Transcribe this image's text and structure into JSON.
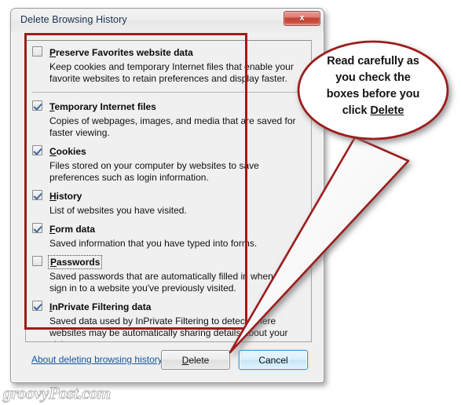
{
  "window": {
    "title": "Delete Browsing History",
    "close_label": "x",
    "close_icon": "close-icon"
  },
  "list": {
    "items": [
      {
        "checked": false,
        "accel_prefix": "P",
        "accel_rest": "reserve Favorites website data",
        "label": "Preserve Favorites website data",
        "desc": "Keep cookies and temporary Internet files that enable your favorite websites to retain preferences and display faster.",
        "focused": false,
        "separator_after": true
      },
      {
        "checked": true,
        "accel_prefix": "T",
        "accel_rest": "emporary Internet files",
        "label": "Temporary Internet files",
        "desc": "Copies of webpages, images, and media that are saved for faster viewing.",
        "focused": false,
        "separator_after": false
      },
      {
        "checked": true,
        "accel_prefix": "C",
        "accel_rest": "ookies",
        "label": "Cookies",
        "desc": "Files stored on your computer by websites to save preferences such as login information.",
        "focused": false,
        "separator_after": false
      },
      {
        "checked": true,
        "accel_prefix": "H",
        "accel_rest": "istory",
        "label": "History",
        "desc": "List of websites you have visited.",
        "focused": false,
        "separator_after": false
      },
      {
        "checked": true,
        "accel_prefix": "F",
        "accel_rest": "orm data",
        "label": "Form data",
        "desc": "Saved information that you have typed into forms.",
        "focused": false,
        "separator_after": false
      },
      {
        "checked": false,
        "accel_prefix": "P",
        "accel_rest": "asswords",
        "label": "Passwords",
        "desc": "Saved passwords that are automatically filled in when you sign in to a website you've previously visited.",
        "focused": true,
        "separator_after": false
      },
      {
        "checked": true,
        "accel_prefix": "I",
        "accel_rest": "nPrivate Filtering data",
        "label": "InPrivate Filtering data",
        "desc": "Saved data used by InPrivate Filtering to detect where websites may be automatically sharing details about your visit.",
        "focused": false,
        "separator_after": false
      }
    ]
  },
  "footer": {
    "about_link": "About deleting browsing history",
    "delete_label": "Delete",
    "delete_accel_prefix": "D",
    "delete_accel_rest": "elete",
    "cancel_label": "Cancel"
  },
  "annotation": {
    "callout_line1": "Read carefully as",
    "callout_line2": "you check the",
    "callout_line3": "boxes before you",
    "callout_line4_pre": "click ",
    "callout_line4_emph": "Delete",
    "accent_color": "#9e1b1b"
  },
  "watermark": {
    "text": "groovyPost.com"
  }
}
